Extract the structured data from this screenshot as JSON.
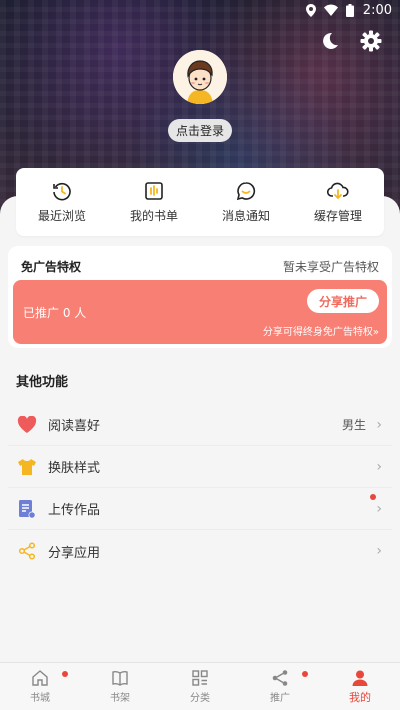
{
  "status_bar": {
    "time": "2:00"
  },
  "profile": {
    "login_label": "点击登录"
  },
  "quick_actions": [
    {
      "label": "最近浏览",
      "icon": "history-icon"
    },
    {
      "label": "我的书单",
      "icon": "booklist-icon"
    },
    {
      "label": "消息通知",
      "icon": "message-icon"
    },
    {
      "label": "缓存管理",
      "icon": "cloud-download-icon"
    }
  ],
  "promo": {
    "title": "免广告特权",
    "status": "暂未享受广告特权",
    "count_text": "已推广 0 人",
    "share_button": "分享推广",
    "hint": "分享可得终身免广告特权»"
  },
  "other_section": {
    "title": "其他功能",
    "items": [
      {
        "label": "阅读喜好",
        "value": "男生",
        "icon": "heart-icon"
      },
      {
        "label": "换肤样式",
        "value": "",
        "icon": "tshirt-icon"
      },
      {
        "label": "上传作品",
        "value": "",
        "icon": "upload-doc-icon"
      },
      {
        "label": "分享应用",
        "value": "",
        "icon": "share-icon"
      }
    ]
  },
  "bottom_nav": [
    {
      "label": "书城",
      "icon": "home-icon"
    },
    {
      "label": "书架",
      "icon": "bookshelf-icon"
    },
    {
      "label": "分类",
      "icon": "category-icon"
    },
    {
      "label": "推广",
      "icon": "share-icon"
    },
    {
      "label": "我的",
      "icon": "user-icon",
      "active": true
    }
  ],
  "colors": {
    "accent": "#e8483c",
    "promo_bg": "#f87f73",
    "icon_amber": "#f5b623"
  }
}
